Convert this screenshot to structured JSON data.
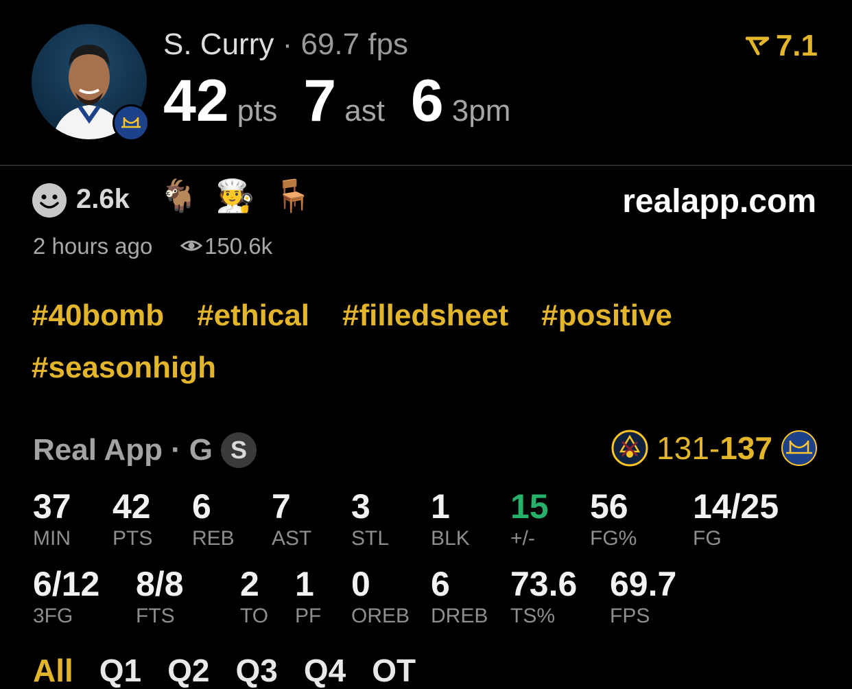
{
  "header": {
    "player_name": "S. Curry",
    "separator": "·",
    "fps_text": "69.7 fps",
    "big_stats": [
      {
        "value": "42",
        "unit": "pts"
      },
      {
        "value": "7",
        "unit": "ast"
      },
      {
        "value": "6",
        "unit": "3pm"
      }
    ],
    "rating": "7.1",
    "rating_icon": "trend-arrow-icon"
  },
  "reactions": {
    "count": "2.6k",
    "emojis": [
      "🐐",
      "🧑‍🍳",
      "🪑"
    ],
    "site": "realapp.com",
    "time_ago": "2 hours ago",
    "views": "150.6k"
  },
  "hashtags": [
    "#40bomb",
    "#ethical",
    "#filledsheet",
    "#positive",
    "#seasonhigh"
  ],
  "game": {
    "source": "Real App",
    "separator": "·",
    "position": "G",
    "badge": "S",
    "score_away": "131",
    "score_dash": "-",
    "score_home": "137"
  },
  "stats_row1": [
    {
      "value": "37",
      "label": "MIN"
    },
    {
      "value": "42",
      "label": "PTS"
    },
    {
      "value": "6",
      "label": "REB"
    },
    {
      "value": "7",
      "label": "AST"
    },
    {
      "value": "3",
      "label": "STL"
    },
    {
      "value": "1",
      "label": "BLK"
    },
    {
      "value": "15",
      "label": "+/-"
    },
    {
      "value": "56",
      "label": "FG%"
    },
    {
      "value": "14/25",
      "label": "FG"
    }
  ],
  "stats_row2": [
    {
      "value": "6/12",
      "label": "3FG"
    },
    {
      "value": "8/8",
      "label": "FTS"
    },
    {
      "value": "2",
      "label": "TO"
    },
    {
      "value": "1",
      "label": "PF"
    },
    {
      "value": "0",
      "label": "OREB"
    },
    {
      "value": "6",
      "label": "DREB"
    },
    {
      "value": "73.6",
      "label": "TS%"
    },
    {
      "value": "69.7",
      "label": "FPS"
    }
  ],
  "quarter_tabs": [
    "All",
    "Q1",
    "Q2",
    "Q3",
    "Q4",
    "OT"
  ],
  "colors": {
    "accent": "#e3b52a",
    "positive": "#27b06a",
    "background": "#000000"
  }
}
